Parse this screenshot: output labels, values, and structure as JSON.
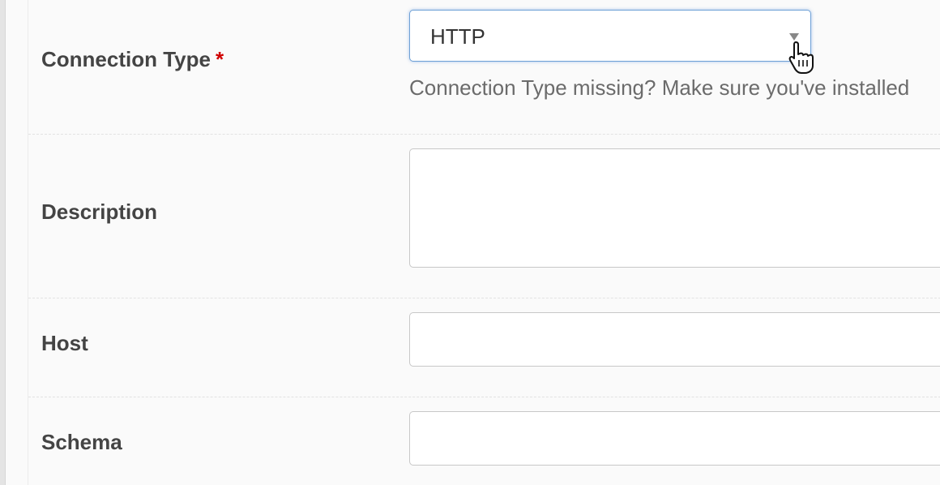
{
  "form": {
    "connection_type": {
      "label": "Connection Type",
      "required_marker": "*",
      "selected_value": "HTTP",
      "help_text": "Connection Type missing? Make sure you've installed"
    },
    "description": {
      "label": "Description",
      "value": ""
    },
    "host": {
      "label": "Host",
      "value": ""
    },
    "schema": {
      "label": "Schema",
      "value": ""
    }
  },
  "colors": {
    "required": "#d00000",
    "focus_border": "#6ea0d6",
    "label": "#444444",
    "help": "#6b6b6b"
  },
  "icons": {
    "select_arrow": "caret-down-icon",
    "cursor": "hand-pointer-cursor-icon"
  }
}
